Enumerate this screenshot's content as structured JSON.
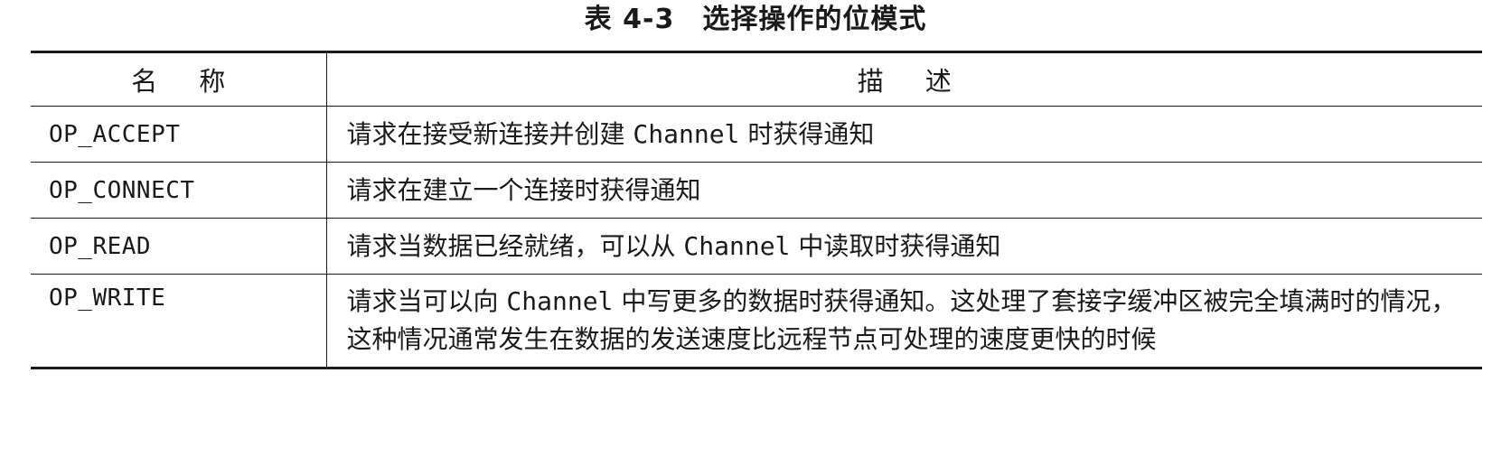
{
  "table": {
    "caption": "表 4-3　选择操作的位模式",
    "headers": {
      "name": "名称",
      "description": "描述"
    },
    "rows": [
      {
        "name": "OP_ACCEPT",
        "desc_before": "请求在接受新连接并创建 ",
        "desc_code": "Channel",
        "desc_after": " 时获得通知"
      },
      {
        "name": "OP_CONNECT",
        "desc_before": "请求在建立一个连接时获得通知",
        "desc_code": "",
        "desc_after": ""
      },
      {
        "name": "OP_READ",
        "desc_before": "请求当数据已经就绪，可以从 ",
        "desc_code": "Channel",
        "desc_after": " 中读取时获得通知"
      },
      {
        "name": "OP_WRITE",
        "desc_before": "请求当可以向 ",
        "desc_code": "Channel",
        "desc_after": " 中写更多的数据时获得通知。这处理了套接字缓冲区被完全填满时的情况，这种情况通常发生在数据的发送速度比远程节点可处理的速度更快的时候"
      }
    ]
  }
}
